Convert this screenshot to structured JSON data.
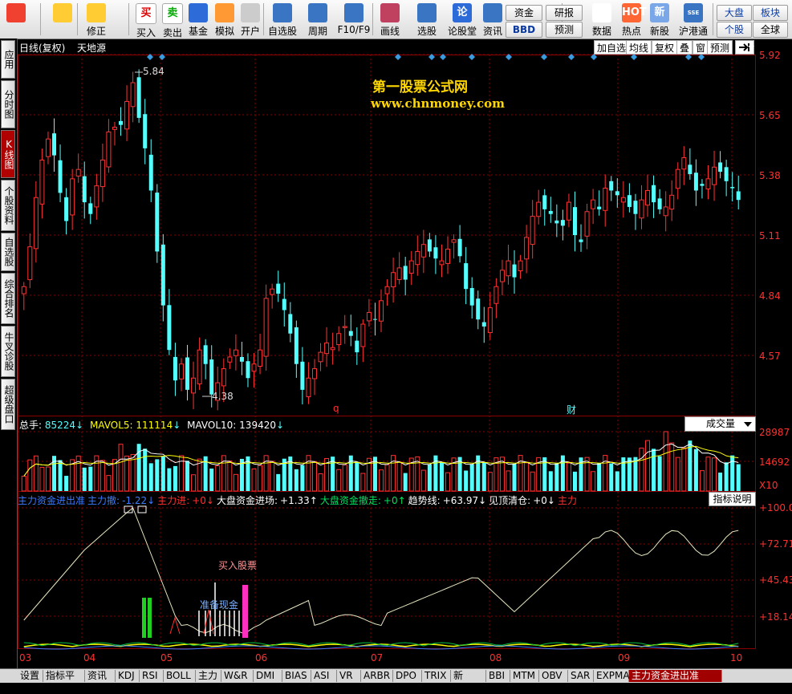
{
  "toolbar": {
    "items": [
      {
        "name": "app-logo",
        "label": ""
      },
      {
        "name": "back",
        "label": ""
      },
      {
        "name": "repair",
        "label": "修正"
      },
      {
        "name": "buy",
        "label": "买入"
      },
      {
        "name": "sell",
        "label": "卖出"
      },
      {
        "name": "fund",
        "label": "基金"
      },
      {
        "name": "simulate",
        "label": "模拟"
      },
      {
        "name": "open-account",
        "label": "开户"
      },
      {
        "name": "watchlist",
        "label": "自选股"
      },
      {
        "name": "period",
        "label": "周期"
      },
      {
        "name": "f10",
        "label": "F10/F9"
      },
      {
        "name": "draw",
        "label": "画线"
      },
      {
        "name": "pick",
        "label": "选股"
      },
      {
        "name": "forum",
        "label": "论股堂"
      },
      {
        "name": "news",
        "label": "资讯"
      },
      {
        "name": "data",
        "label": "数据"
      },
      {
        "name": "hot",
        "label": "热点"
      },
      {
        "name": "new-stock",
        "label": "新股"
      },
      {
        "name": "hk-connect",
        "label": "沪港通"
      }
    ],
    "small_buttons": {
      "capital": "资金",
      "bbd": "BBD",
      "research": "研报",
      "forecast": "预测",
      "market": "大盘",
      "sector": "板块",
      "individual": "个股",
      "global": "全球"
    },
    "icon_glyphs": {
      "buy": "买",
      "sell": "卖",
      "forum": "论",
      "data": "PE",
      "hot": "HOT",
      "new-stock": "新",
      "hk-connect": "SSE HKE"
    }
  },
  "left_tabs": [
    {
      "label": "应用"
    },
    {
      "label": "分时图"
    },
    {
      "label": "K线图",
      "active": true
    },
    {
      "label": "个股资料"
    },
    {
      "label": "自选股"
    },
    {
      "label": "综合排名"
    },
    {
      "label": "牛叉诊股"
    },
    {
      "label": "超级盘口"
    }
  ],
  "chart_header": {
    "period": "日线(复权)",
    "stock_name": "天地源",
    "buttons": [
      "加自选",
      "均线",
      "复权",
      "叠",
      "窗",
      "预测"
    ],
    "watermark_title": "第一股票公式网",
    "watermark_url": "www.chnmoney.com",
    "event_markers": [
      "q",
      "财"
    ],
    "high_label": "5.84",
    "low_label": "4.38"
  },
  "price_axis": [
    "5.92",
    "5.65",
    "5.38",
    "5.11",
    "4.84",
    "4.57"
  ],
  "volume": {
    "legend_total_label": "总手:",
    "legend_total_value": "85224",
    "legend_ma5_label": "MAVOL5:",
    "legend_ma5_value": "111114",
    "legend_ma10_label": "MAVOL10:",
    "legend_ma10_value": "139420",
    "selector": "成交量",
    "axis": [
      "28987",
      "14692",
      "X10"
    ]
  },
  "indicator": {
    "legend": [
      {
        "text": "主力资金进出准",
        "color": "#3a7bff"
      },
      {
        "text": "主力撤:",
        "color": "#3a7bff"
      },
      {
        "text": "-1.22↓",
        "color": "#3a7bff"
      },
      {
        "text": "主力进:",
        "color": "#ff3030"
      },
      {
        "text": "+0↓",
        "color": "#ff3030"
      },
      {
        "text": "大盘资金进场:",
        "color": "#ffffff"
      },
      {
        "text": "+1.33↑",
        "color": "#ffffff"
      },
      {
        "text": "大盘资金撤走:",
        "color": "#00e060"
      },
      {
        "text": "+0↑",
        "color": "#00e060"
      },
      {
        "text": "趋势线:",
        "color": "#ffffff"
      },
      {
        "text": "+63.97↓",
        "color": "#ffffff"
      },
      {
        "text": "见顶清仓:",
        "color": "#ffffff"
      },
      {
        "text": "+0↓",
        "color": "#ffffff"
      },
      {
        "text": "主力",
        "color": "#ff3030"
      }
    ],
    "help_button": "指标说明",
    "axis": [
      "+100.0",
      "+72.71",
      "+45.43",
      "+18.14"
    ],
    "annotations": {
      "buy": "买入股票",
      "prepare": "准备现金"
    }
  },
  "date_axis": [
    "03",
    "04",
    "05",
    "06",
    "07",
    "08",
    "09",
    "10"
  ],
  "bottom_tabs": [
    "设置",
    "指标平台",
    "资讯",
    "KDJ",
    "RSI",
    "BOLL",
    "主力",
    "W&R",
    "DMI",
    "BIAS",
    "ASI",
    "VR",
    "ARBR",
    "DPO",
    "TRIX",
    "新DMA",
    "BBI",
    "MTM",
    "OBV",
    "SAR",
    "EXPMA",
    "主力资金进出准"
  ],
  "colors": {
    "up": "#ff3232",
    "down": "#54ffff",
    "grid": "#8b0000",
    "ma5": "#ffffff",
    "ma10": "#ffff00"
  },
  "chart_data": [
    {
      "type": "candlestick",
      "title": "",
      "price_high": 5.84,
      "price_low": 4.38,
      "ylim": [
        4.38,
        5.92
      ],
      "yticks": [
        5.92,
        5.65,
        5.38,
        5.11,
        4.84,
        4.57
      ],
      "months": [
        "03",
        "04",
        "05",
        "06",
        "07",
        "08",
        "09",
        "10"
      ],
      "closes": [
        4.93,
        5.1,
        5.31,
        5.47,
        5.56,
        5.49,
        5.33,
        5.21,
        5.39,
        5.43,
        5.29,
        5.24,
        5.36,
        5.47,
        5.59,
        5.61,
        5.62,
        5.72,
        5.8,
        5.65,
        5.52,
        5.34,
        5.08,
        4.85,
        4.66,
        4.53,
        4.6,
        4.49,
        4.54,
        4.66,
        4.6,
        4.47,
        4.52,
        4.58,
        4.63,
        4.66,
        4.61,
        4.54,
        4.6,
        4.66,
        4.88,
        4.92,
        4.9,
        4.83,
        4.73,
        4.6,
        4.49,
        4.54,
        4.58,
        4.65,
        4.69,
        4.67,
        4.73,
        4.76,
        4.72,
        4.65,
        4.77,
        4.82,
        4.79,
        4.87,
        4.93,
        4.99,
        5.01,
        4.96,
        5.04,
        5.08,
        5.11,
        5.08,
        5.05,
        5.04,
        5.09,
        5.13,
        5.06,
        4.92,
        4.85,
        4.79,
        4.76,
        4.84,
        4.93,
        5.0,
        5.04,
        4.97,
        5.04,
        5.14,
        5.23,
        5.29,
        5.26,
        5.24,
        5.2,
        5.19,
        5.29,
        5.15,
        5.12,
        5.25,
        5.3,
        5.26,
        5.35,
        5.34,
        5.32,
        5.31,
        5.27,
        5.24,
        5.3,
        5.34,
        5.29,
        5.26,
        5.27,
        5.32,
        5.43,
        5.48,
        5.41,
        5.34,
        5.36,
        5.39,
        5.44,
        5.42,
        5.38,
        5.35,
        5.3
      ]
    },
    {
      "type": "bar",
      "title": "成交量",
      "ylim": [
        0,
        28987
      ],
      "last_value": 85224,
      "mavol5": 111114,
      "mavol10": 139420
    },
    {
      "type": "line",
      "title": "主力资金进出准",
      "ylim": [
        0,
        100
      ],
      "trend_line_last": 63.97,
      "main_force_withdraw_last": -1.22,
      "market_inflow_last": 1.33
    }
  ]
}
